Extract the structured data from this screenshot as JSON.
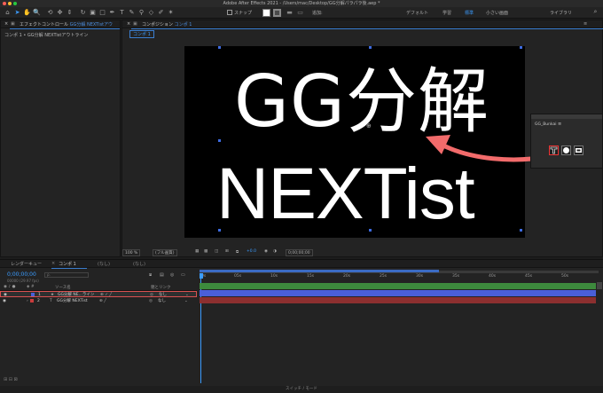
{
  "window": {
    "title": "Adobe After Effects 2021 - /Users/mac/Desktop/GG分解パラパラ後.aep *"
  },
  "toolbar": {
    "snap_label": "スナップ",
    "add_label": "追加:",
    "workspaces": [
      "デフォルト",
      "学習",
      "標準",
      "小さい画面",
      "ライブラリ"
    ],
    "active_workspace_index": 2,
    "fill_color": "#ffffff",
    "stroke_color": "#4a4a4a"
  },
  "effect_controls": {
    "tab_label": "エフェクトコントロール",
    "tab_target": "GG分解 NEXTistアウ",
    "breadcrumb": "コンポ 1 • GG分解 NEXTistアウトライン"
  },
  "composition": {
    "tab_label": "コンポジション",
    "tab_target": "コンポ 1",
    "subtab": "コンポ 1",
    "canvas_text_line1": "GG分解",
    "canvas_text_line2": "NEXTist",
    "zoom": "100 %",
    "resolution": "(フル画質)",
    "timecode": "0;00;00;00",
    "plus": "+0.0"
  },
  "gg_panel": {
    "title": "GG_Bunkai",
    "menu": "≡",
    "buttons": [
      "split-text-icon",
      "circle-icon",
      "export-icon"
    ],
    "selected_button": 0,
    "arrow_color": "#f26b6b"
  },
  "timeline": {
    "tabs": [
      "レンダーキュー",
      "コンポ 1",
      "(なし)",
      "(なし)"
    ],
    "timecode": "0;00;00;00",
    "fps": "00000 (29.97 fps)",
    "search_placeholder": "ρ.",
    "columns": {
      "source": "ソース名",
      "parent": "親とリンク"
    },
    "layers": [
      {
        "num": "1",
        "name": "GG分解 NE...ライン",
        "parent": "なし",
        "label_color": "#4a5fd8",
        "selected": true
      },
      {
        "num": "2",
        "name": "GG分解 NEXTist",
        "parent": "なし",
        "label_color": "#c93c3c",
        "selected": false
      }
    ],
    "ruler": [
      "0s",
      "05s",
      "10s",
      "15s",
      "20s",
      "25s",
      "30s",
      "35s",
      "40s",
      "45s",
      "50s"
    ],
    "footer": "スイッチ / モード"
  }
}
